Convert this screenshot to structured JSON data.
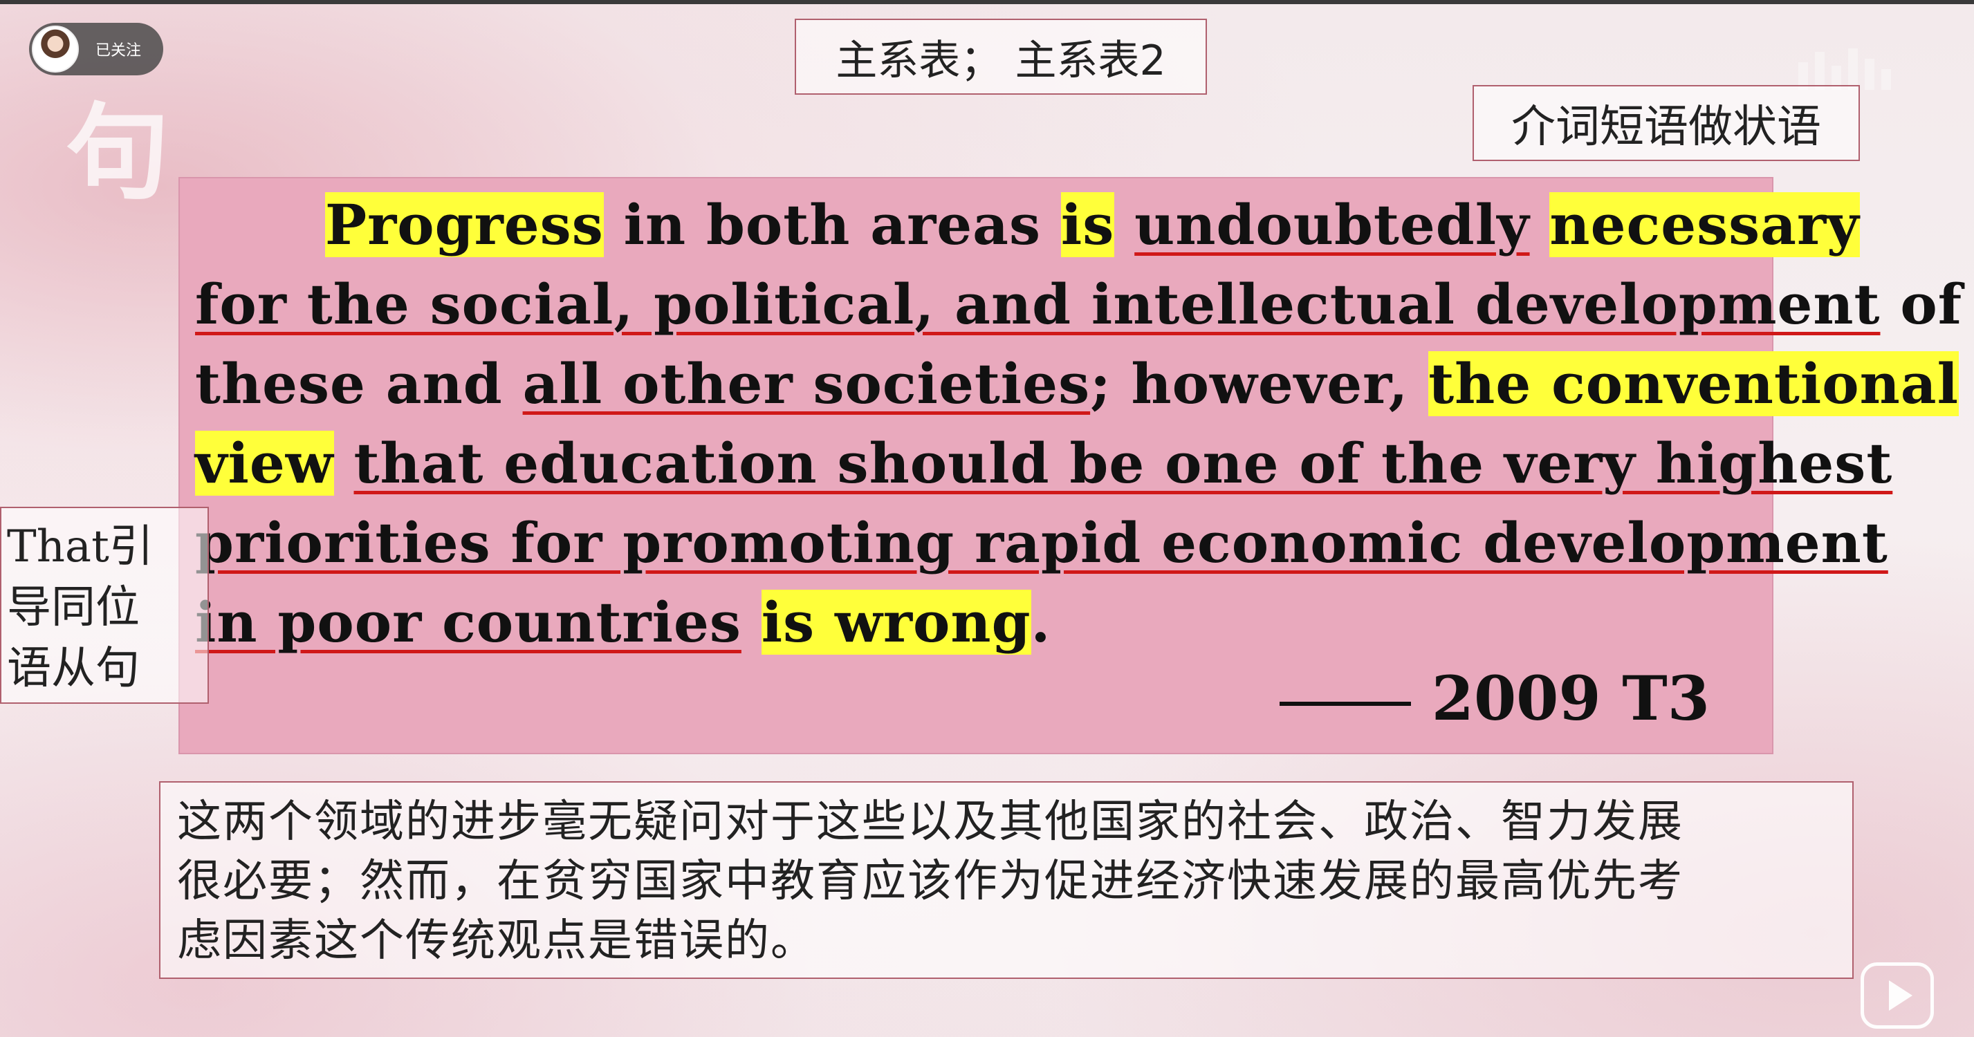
{
  "overlay": {
    "watermark_char": "句",
    "follow_label": "已关注"
  },
  "labels": {
    "title": "主系表； 主系表2",
    "right_note": "介词短语做状语",
    "left_note_lines": [
      "That引",
      "导同位",
      "语从句"
    ]
  },
  "sentence": {
    "line1": {
      "a": "Progress",
      "b": " in both areas ",
      "c": "is",
      "d": " ",
      "e": "undoubtedly",
      "f": " ",
      "g": "necessary"
    },
    "line2": {
      "a": "for the social, political, and intellectual development",
      "b": " of"
    },
    "line3": {
      "a": "these and ",
      "b": "all other societies",
      "c": "; however, ",
      "d": "the conventional"
    },
    "line4": {
      "a": "view",
      "b": " ",
      "c": "that education should be one of the very highest"
    },
    "line5": {
      "a": "priorities for promoting rapid economic development"
    },
    "line6": {
      "a": "in poor countries",
      "b": " ",
      "c": "is wrong",
      "d": "."
    },
    "source": "2009 T3"
  },
  "translation": {
    "line1": "这两个领域的进步毫无疑问对于这些以及其他国家的社会、政治、智力发展",
    "line2": "很必要；然而，在贫穷国家中教育应该作为促进经济快速发展的最高优先考",
    "line3": "虑因素这个传统观点是错误的。"
  },
  "icons": {
    "play": "play-icon",
    "avatar": "avatar",
    "logo": "site-logo-watermark"
  },
  "colors": {
    "highlight": "#ffff3a",
    "underline": "#d01818",
    "panel": "#e9a9bd",
    "border": "#b0606e"
  }
}
